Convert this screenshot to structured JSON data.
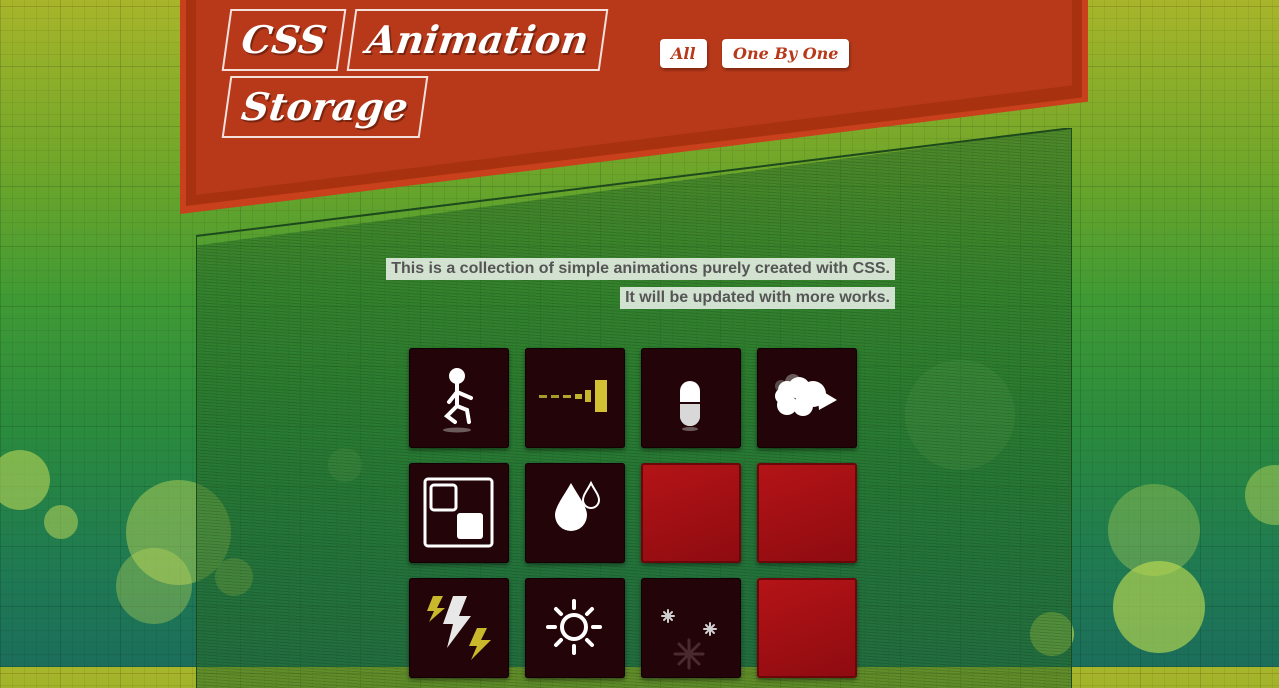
{
  "header": {
    "title_words": [
      "CSS",
      "Animation",
      "Storage"
    ],
    "buttons": {
      "all": "All",
      "one_by_one": "One By One"
    }
  },
  "intro": {
    "line1": "This is a collection of simple animations purely created with CSS.",
    "line2": "It will be updated with more works."
  },
  "tiles": [
    {
      "icon": "stickman-jump-icon"
    },
    {
      "icon": "loading-bars-icon"
    },
    {
      "icon": "pill-icon"
    },
    {
      "icon": "clouds-icon"
    },
    {
      "icon": "squares-icon"
    },
    {
      "icon": "water-drops-icon"
    },
    {
      "icon": "empty"
    },
    {
      "icon": "empty"
    },
    {
      "icon": "lightning-icon"
    },
    {
      "icon": "sun-icon"
    },
    {
      "icon": "snowflakes-icon"
    },
    {
      "icon": "empty"
    }
  ],
  "colors": {
    "header_red": "#b8391a",
    "tile_dark": "#230408",
    "tile_red": "#a31015",
    "accent_yellow": "#c9b82c"
  }
}
